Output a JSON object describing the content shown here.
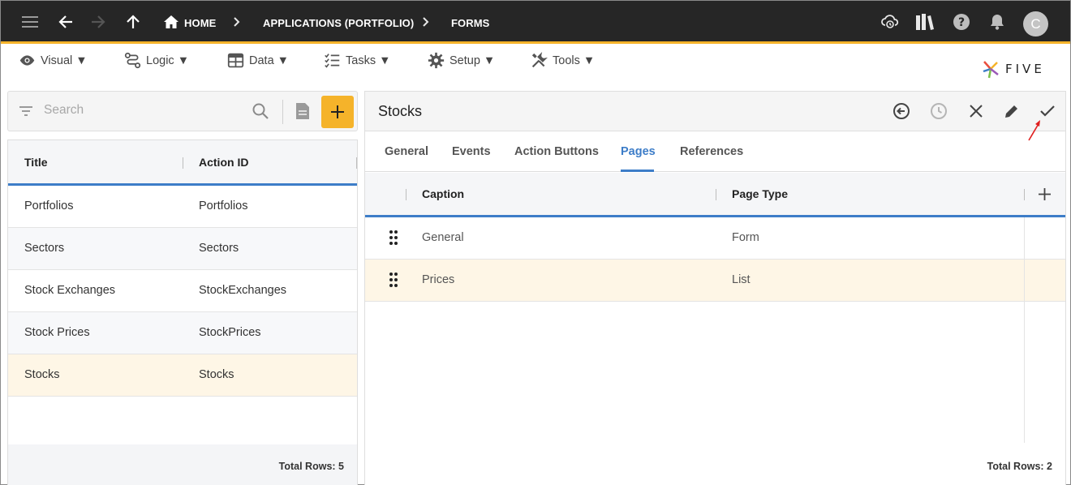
{
  "topbar": {
    "breadcrumbs": [
      "HOME",
      "APPLICATIONS (PORTFOLIO)",
      "FORMS"
    ],
    "avatar_initial": "C"
  },
  "menu": {
    "items": [
      {
        "label": "Visual ▼",
        "icon": "eye-icon"
      },
      {
        "label": "Logic ▼",
        "icon": "logic-icon"
      },
      {
        "label": "Data ▼",
        "icon": "table-icon"
      },
      {
        "label": "Tasks ▼",
        "icon": "tasks-icon"
      },
      {
        "label": "Setup ▼",
        "icon": "gear-icon"
      },
      {
        "label": "Tools ▼",
        "icon": "tools-icon"
      }
    ],
    "logo_text": "FIVE"
  },
  "left": {
    "search_placeholder": "Search",
    "columns": [
      "Title",
      "Action ID"
    ],
    "rows": [
      {
        "title": "Portfolios",
        "action_id": "Portfolios"
      },
      {
        "title": "Sectors",
        "action_id": "Sectors"
      },
      {
        "title": "Stock Exchanges",
        "action_id": "StockExchanges"
      },
      {
        "title": "Stock Prices",
        "action_id": "StockPrices"
      },
      {
        "title": "Stocks",
        "action_id": "Stocks"
      }
    ],
    "total": "Total Rows: 5"
  },
  "right": {
    "title": "Stocks",
    "tabs": [
      "General",
      "Events",
      "Action Buttons",
      "Pages",
      "References"
    ],
    "active_tab": "Pages",
    "columns": [
      "Caption",
      "Page Type"
    ],
    "rows": [
      {
        "caption": "General",
        "page_type": "Form"
      },
      {
        "caption": "Prices",
        "page_type": "List"
      }
    ],
    "total": "Total Rows: 2"
  },
  "colors": {
    "accent": "#f5b32a",
    "primary": "#3d7dc8",
    "topbar": "#262626",
    "selected_row": "#fef6e6",
    "annotation_arrow": "#e02020"
  }
}
